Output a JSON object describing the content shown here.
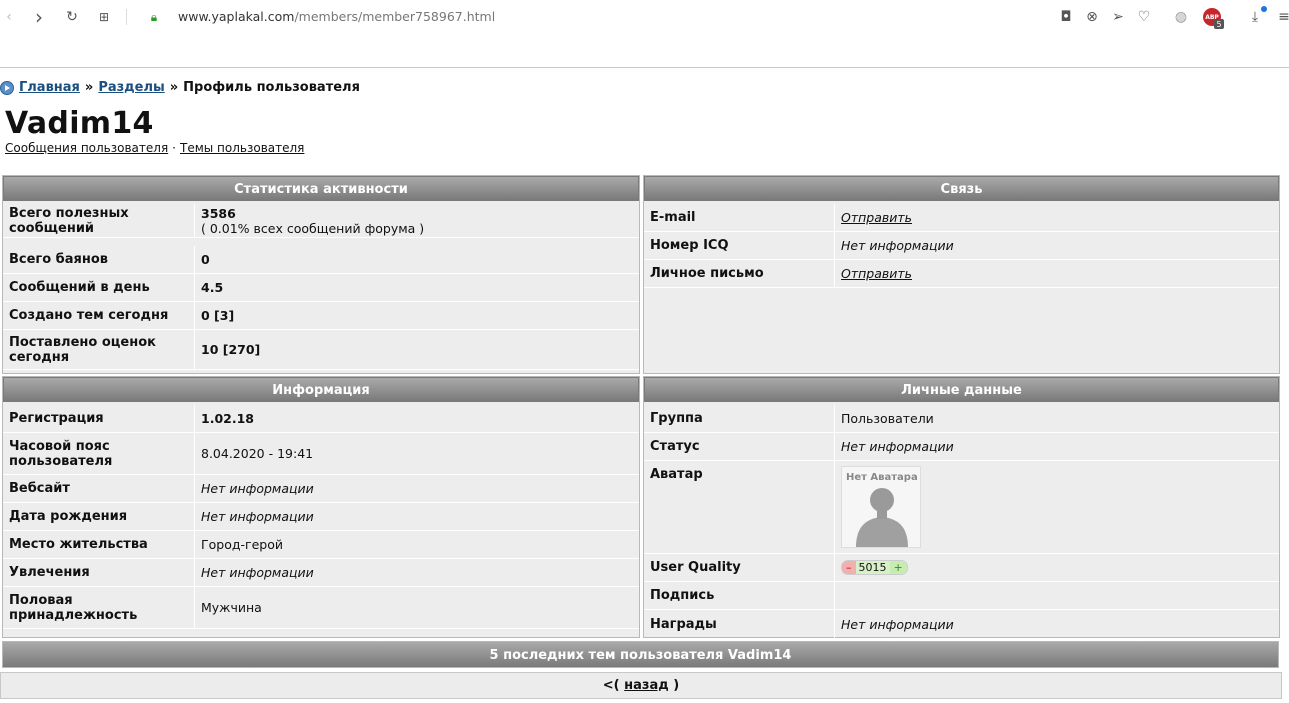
{
  "browser": {
    "url_host": "www.yaplakal.com",
    "url_path": "/members/member758967.html",
    "adblock_label": "ABP",
    "adblock_count": "5"
  },
  "breadcrumb": {
    "home": "Главная",
    "sep": "»",
    "sections": "Разделы",
    "current": "Профиль пользователя"
  },
  "user": {
    "name": "Vadim14",
    "link_posts": "Сообщения пользователя",
    "link_dot": "·",
    "link_topics": "Темы пользователя"
  },
  "activity": {
    "title": "Статистика активности",
    "rows": [
      {
        "k": "Всего полезных сообщений",
        "v": "3586",
        "sub": "( 0.01% всех сообщений форума )"
      },
      {
        "k": "Всего баянов",
        "v": "0"
      },
      {
        "k": "Сообщений в день",
        "v": "4.5"
      },
      {
        "k": "Создано тем сегодня",
        "v": "0 [3]"
      },
      {
        "k": "Поставлено оценок сегодня",
        "v": "10 [270]"
      }
    ]
  },
  "contact": {
    "title": "Связь",
    "rows": [
      {
        "k": "E-mail",
        "v": "Отправить"
      },
      {
        "k": "Номер ICQ",
        "v": "Нет информации"
      },
      {
        "k": "Личное письмо",
        "v": "Отправить"
      }
    ]
  },
  "info": {
    "title": "Информация",
    "rows": [
      {
        "k": "Регистрация",
        "v": "1.02.18"
      },
      {
        "k": "Часовой пояс пользователя",
        "v": "8.04.2020 - 19:41"
      },
      {
        "k": "Вебсайт",
        "v": "Нет информации"
      },
      {
        "k": "Дата рождения",
        "v": "Нет информации"
      },
      {
        "k": "Место жительства",
        "v": "Город-герой"
      },
      {
        "k": "Увлечения",
        "v": "Нет информации"
      },
      {
        "k": "Половая принадлежность",
        "v": "Мужчина"
      }
    ]
  },
  "personal": {
    "title": "Личные данные",
    "rows": [
      {
        "k": "Группа",
        "v": "Пользователи"
      },
      {
        "k": "Статус",
        "v": "Нет информации"
      },
      {
        "k": "Аватар",
        "v": "Нет Аватара"
      },
      {
        "k": "User Quality",
        "minus": "–",
        "value": "5015",
        "plus": "+"
      },
      {
        "k": "Подпись",
        "v": ""
      },
      {
        "k": "Награды",
        "v": "Нет информации"
      }
    ]
  },
  "last_topics": "5 последних тем пользователя Vadim14",
  "back": {
    "prefix": "<(",
    "link": "назад",
    "suffix": ")"
  }
}
